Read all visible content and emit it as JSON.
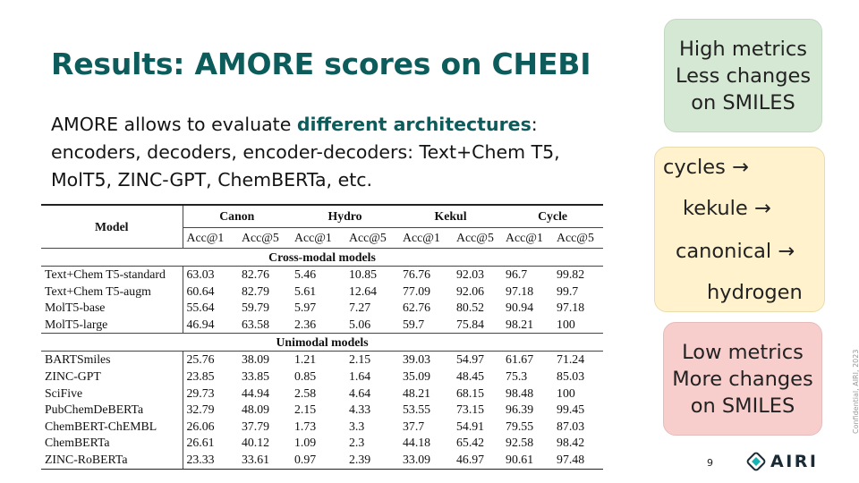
{
  "slide": {
    "title": "Results: AMORE scores on CHEBI",
    "intro": {
      "part1": "AMORE allows to evaluate ",
      "highlight": "different architectures",
      "part2": ": encoders, decoders, encoder-decoders: Text+Chem T5, MolT5, ZINC-GPT, ChemBERTa, etc."
    },
    "page_number": "9",
    "confidential": "Confidential, AIRI, 2023",
    "logo_text": "AIRI",
    "accent_color": "#0d5c5c"
  },
  "table": {
    "model_header": "Model",
    "groups": [
      "Canon",
      "Hydro",
      "Kekul",
      "Cycle"
    ],
    "metrics": [
      "Acc@1",
      "Acc@5",
      "Acc@1",
      "Acc@5",
      "Acc@1",
      "Acc@5",
      "Acc@1",
      "Acc@5"
    ],
    "sections": [
      {
        "title": "Cross-modal models",
        "rows": [
          {
            "model": "Text+Chem T5-standard",
            "values": [
              "63.03",
              "82.76",
              "5.46",
              "10.85",
              "76.76",
              "92.03",
              "96.7",
              "99.82"
            ]
          },
          {
            "model": "Text+Chem T5-augm",
            "values": [
              "60.64",
              "82.79",
              "5.61",
              "12.64",
              "77.09",
              "92.06",
              "97.18",
              "99.7"
            ]
          },
          {
            "model": "MolT5-base",
            "values": [
              "55.64",
              "59.79",
              "5.97",
              "7.27",
              "62.76",
              "80.52",
              "90.94",
              "97.18"
            ]
          },
          {
            "model": "MolT5-large",
            "values": [
              "46.94",
              "63.58",
              "2.36",
              "5.06",
              "59.7",
              "75.84",
              "98.21",
              "100"
            ]
          }
        ]
      },
      {
        "title": "Unimodal models",
        "rows": [
          {
            "model": "BARTSmiles",
            "values": [
              "25.76",
              "38.09",
              "1.21",
              "2.15",
              "39.03",
              "54.97",
              "61.67",
              "71.24"
            ]
          },
          {
            "model": "ZINC-GPT",
            "values": [
              "23.85",
              "33.85",
              "0.85",
              "1.64",
              "35.09",
              "48.45",
              "75.3",
              "85.03"
            ]
          },
          {
            "model": "SciFive",
            "values": [
              "29.73",
              "44.94",
              "2.58",
              "4.64",
              "48.21",
              "68.15",
              "98.48",
              "100"
            ]
          },
          {
            "model": "PubChemDeBERTa",
            "values": [
              "32.79",
              "48.09",
              "2.15",
              "4.33",
              "53.55",
              "73.15",
              "96.39",
              "99.45"
            ]
          },
          {
            "model": "ChemBERT-ChEMBL",
            "values": [
              "26.06",
              "37.79",
              "1.73",
              "3.3",
              "37.7",
              "54.91",
              "79.55",
              "87.03"
            ]
          },
          {
            "model": "ChemBERTa",
            "values": [
              "26.61",
              "40.12",
              "1.09",
              "2.3",
              "44.18",
              "65.42",
              "92.58",
              "98.42"
            ]
          },
          {
            "model": "ZINC-RoBERTa",
            "values": [
              "23.33",
              "33.61",
              "0.97",
              "2.39",
              "33.09",
              "46.97",
              "90.61",
              "97.48"
            ]
          }
        ]
      }
    ]
  },
  "callouts": {
    "high": [
      "High metrics",
      "Less changes",
      "on SMILES"
    ],
    "steps": [
      "cycles →",
      "kekule →",
      "canonical →",
      "hydrogen"
    ],
    "low": [
      "Low metrics",
      "More changes",
      "on SMILES"
    ]
  }
}
